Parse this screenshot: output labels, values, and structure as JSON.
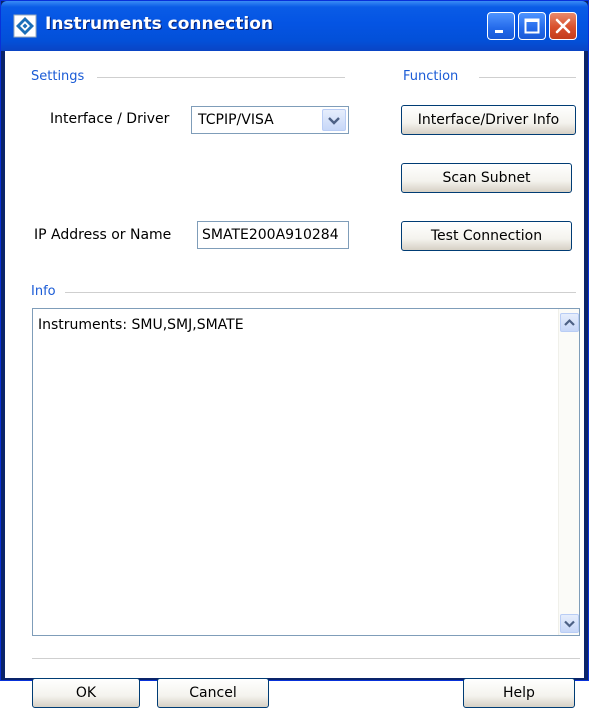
{
  "window": {
    "title": "Instruments connection",
    "title_bar_color": "#0a5ce6",
    "close_button_color": "#d8502c",
    "icons": [
      "app-diamond-icon",
      "minimize-icon",
      "maximize-icon",
      "close-icon"
    ]
  },
  "settings": {
    "group_label": "Settings",
    "interface_label": "Interface / Driver",
    "interface_value": "TCPIP/VISA",
    "ip_label": "IP Address or Name",
    "ip_value": "SMATE200A910284"
  },
  "function": {
    "group_label": "Function",
    "interface_info_button": "Interface/Driver Info",
    "scan_subnet_button": "Scan Subnet",
    "test_connection_button": "Test Connection"
  },
  "info": {
    "group_label": "Info",
    "text": "Instruments: SMU,SMJ,SMATE"
  },
  "footer": {
    "ok_button": "OK",
    "cancel_button": "Cancel",
    "help_button": "Help"
  },
  "accent_color": "#1a5bd6"
}
